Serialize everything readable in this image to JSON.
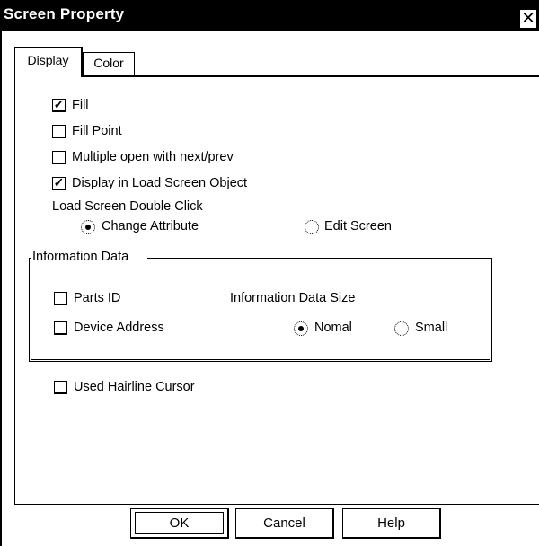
{
  "dialog": {
    "title": "Screen Property",
    "close_glyph": "✕"
  },
  "tabs": [
    {
      "label": "Display",
      "active": true
    },
    {
      "label": "Color",
      "active": false
    }
  ],
  "options": {
    "fill": {
      "label": "Fill",
      "checked": true
    },
    "fill_point": {
      "label": "Fill Point",
      "checked": false
    },
    "multiple_open": {
      "label": "Multiple open with next/prev",
      "checked": false
    },
    "display_in_load": {
      "label": "Display in Load Screen Object",
      "checked": true
    }
  },
  "load_double_click": {
    "label": "Load Screen Double Click",
    "change_attribute": {
      "label": "Change Attribute",
      "selected": true
    },
    "edit_screen": {
      "label": "Edit Screen",
      "selected": false
    }
  },
  "information_data": {
    "title": "Information Data",
    "parts_id": {
      "label": "Parts ID",
      "checked": false
    },
    "device_address": {
      "label": "Device Address",
      "checked": false
    },
    "size_label": "Information Data Size",
    "nomal": {
      "label": "Nomal",
      "selected": true
    },
    "small": {
      "label": "Small",
      "selected": false
    }
  },
  "hairline": {
    "label": "Used Hairline Cursor",
    "checked": false
  },
  "buttons": {
    "ok": "OK",
    "cancel": "Cancel",
    "help": "Help"
  },
  "check_glyph": "✓"
}
